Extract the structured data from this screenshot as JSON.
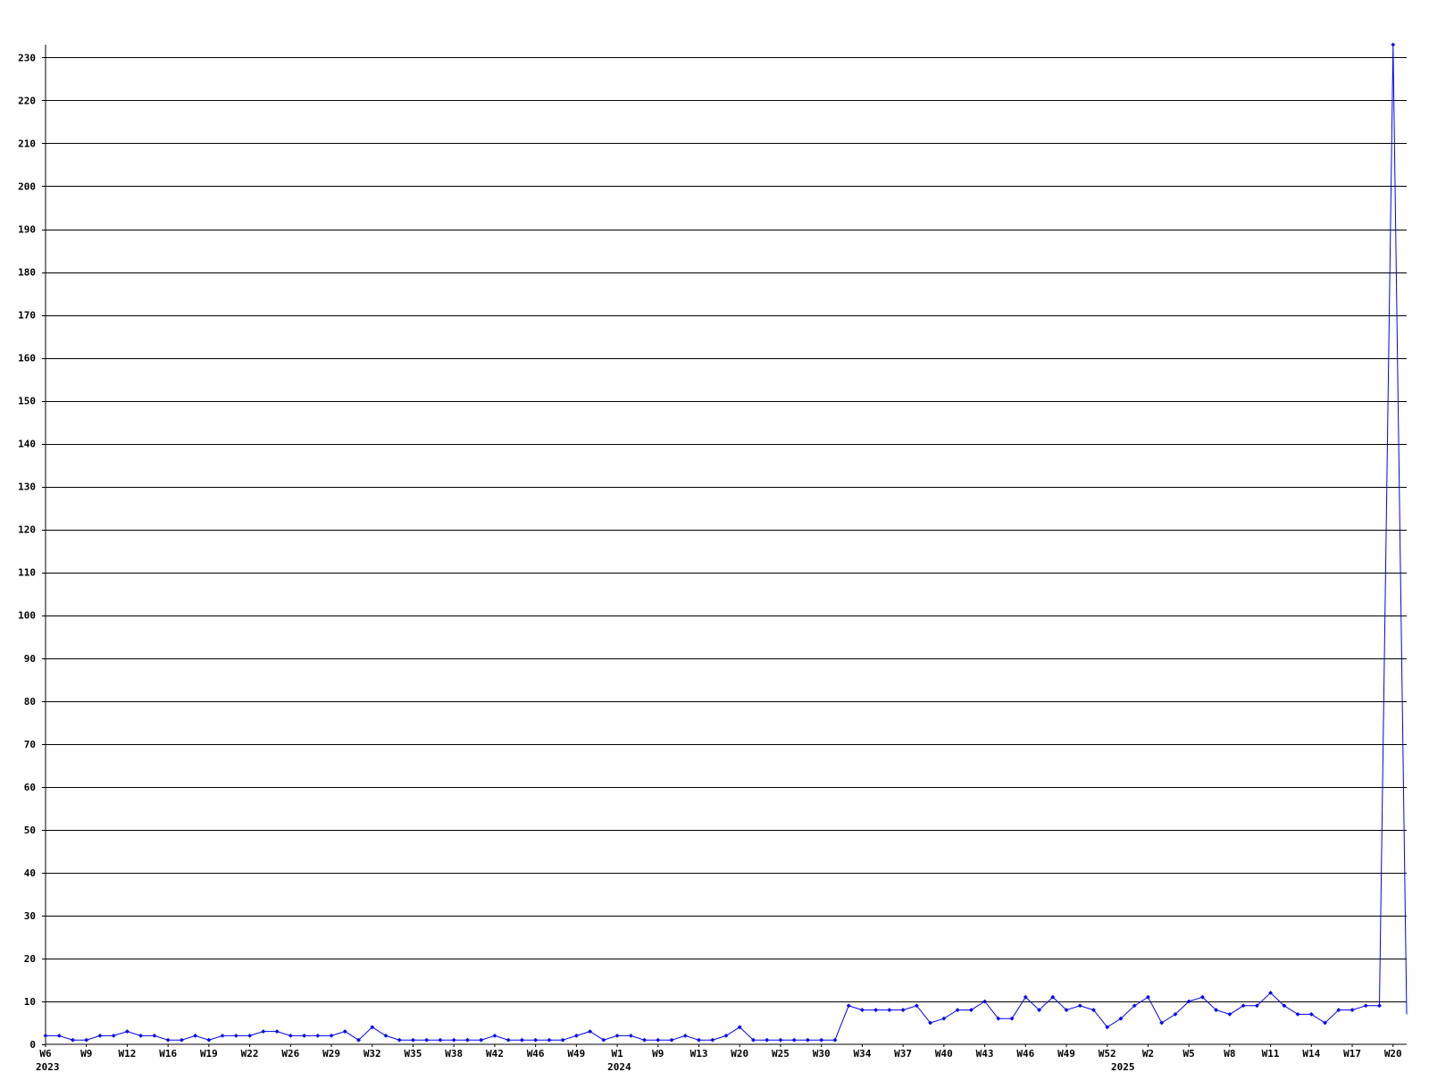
{
  "chart_data": {
    "type": "line",
    "title": "",
    "xlabel": "",
    "ylabel": "",
    "ylim": [
      0,
      233
    ],
    "y_ticks": [
      0,
      10,
      20,
      30,
      40,
      50,
      60,
      70,
      80,
      90,
      100,
      110,
      120,
      130,
      140,
      150,
      160,
      170,
      180,
      190,
      200,
      210,
      220,
      230
    ],
    "grid": true,
    "legend": "none",
    "series_color": "#0000ff",
    "x_week_labels": [
      {
        "index": 0,
        "label": "W6"
      },
      {
        "index": 3,
        "label": "W9"
      },
      {
        "index": 6,
        "label": "W12"
      },
      {
        "index": 9,
        "label": "W16"
      },
      {
        "index": 12,
        "label": "W19"
      },
      {
        "index": 15,
        "label": "W22"
      },
      {
        "index": 18,
        "label": "W26"
      },
      {
        "index": 21,
        "label": "W29"
      },
      {
        "index": 24,
        "label": "W32"
      },
      {
        "index": 27,
        "label": "W35"
      },
      {
        "index": 30,
        "label": "W38"
      },
      {
        "index": 33,
        "label": "W42"
      },
      {
        "index": 36,
        "label": "W46"
      },
      {
        "index": 39,
        "label": "W49"
      },
      {
        "index": 42,
        "label": "W1"
      },
      {
        "index": 45,
        "label": "W9"
      },
      {
        "index": 48,
        "label": "W13"
      },
      {
        "index": 51,
        "label": "W20"
      },
      {
        "index": 54,
        "label": "W25"
      },
      {
        "index": 57,
        "label": "W30"
      },
      {
        "index": 60,
        "label": "W34"
      },
      {
        "index": 63,
        "label": "W37"
      },
      {
        "index": 66,
        "label": "W40"
      },
      {
        "index": 69,
        "label": "W43"
      },
      {
        "index": 72,
        "label": "W46"
      },
      {
        "index": 75,
        "label": "W49"
      },
      {
        "index": 78,
        "label": "W52"
      },
      {
        "index": 81,
        "label": "W2"
      },
      {
        "index": 84,
        "label": "W5"
      },
      {
        "index": 87,
        "label": "W8"
      },
      {
        "index": 90,
        "label": "W11"
      },
      {
        "index": 93,
        "label": "W14"
      },
      {
        "index": 96,
        "label": "W17"
      },
      {
        "index": 99,
        "label": "W20"
      }
    ],
    "x_year_labels": [
      {
        "index": 0,
        "label": "2023"
      },
      {
        "index": 42,
        "label": "2024"
      },
      {
        "index": 79,
        "label": "2025"
      }
    ],
    "values": [
      2,
      2,
      1,
      1,
      2,
      2,
      3,
      2,
      2,
      1,
      1,
      2,
      1,
      2,
      2,
      2,
      3,
      3,
      2,
      2,
      2,
      2,
      3,
      1,
      4,
      2,
      1,
      1,
      1,
      1,
      1,
      1,
      1,
      2,
      1,
      1,
      1,
      1,
      1,
      2,
      3,
      1,
      2,
      2,
      1,
      1,
      1,
      2,
      1,
      1,
      2,
      4,
      1,
      1,
      1,
      1,
      1,
      1,
      1,
      9,
      8,
      8,
      8,
      8,
      9,
      5,
      6,
      8,
      8,
      10,
      6,
      6,
      11,
      8,
      11,
      8,
      9,
      8,
      4,
      6,
      9,
      11,
      5,
      7,
      10,
      11,
      8,
      7,
      9,
      9,
      12,
      9,
      7,
      7,
      5,
      8,
      8,
      9,
      9,
      233,
      7
    ]
  }
}
